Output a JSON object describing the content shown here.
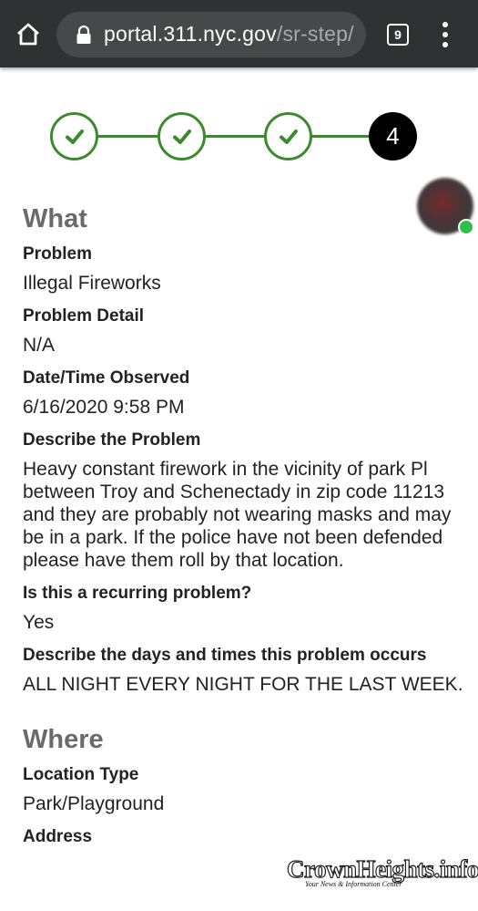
{
  "browser": {
    "url_host": "portal.311.nyc.gov",
    "url_path": "/sr-step/",
    "tab_count": "9"
  },
  "stepper": {
    "current_step": "4",
    "completed_steps": 3
  },
  "what": {
    "title": "What",
    "fields": [
      {
        "label": "Problem",
        "value": "Illegal Fireworks"
      },
      {
        "label": "Problem Detail",
        "value": "N/A"
      },
      {
        "label": "Date/Time Observed",
        "value": "6/16/2020 9:58 PM"
      },
      {
        "label": "Describe the Problem",
        "value": "Heavy constant firework in the vicinity of park Pl between Troy and Schenectady in zip code 11213 and they are probably not wearing masks and may be in a park. If the police have not been defended please have them roll by that location."
      },
      {
        "label": "Is this a recurring problem?",
        "value": "Yes"
      },
      {
        "label": "Describe the days and times this problem occurs",
        "value": "ALL NIGHT EVERY NIGHT FOR THE LAST WEEK."
      }
    ]
  },
  "where": {
    "title": "Where",
    "fields": [
      {
        "label": "Location Type",
        "value": "Park/Playground"
      },
      {
        "label": "Address",
        "value": ""
      }
    ]
  },
  "watermark": {
    "name": "CrownHeights.info",
    "tagline": "Your News & Information Center"
  },
  "colors": {
    "step_green": "#3c8a2e",
    "topbar": "#2f3132"
  }
}
